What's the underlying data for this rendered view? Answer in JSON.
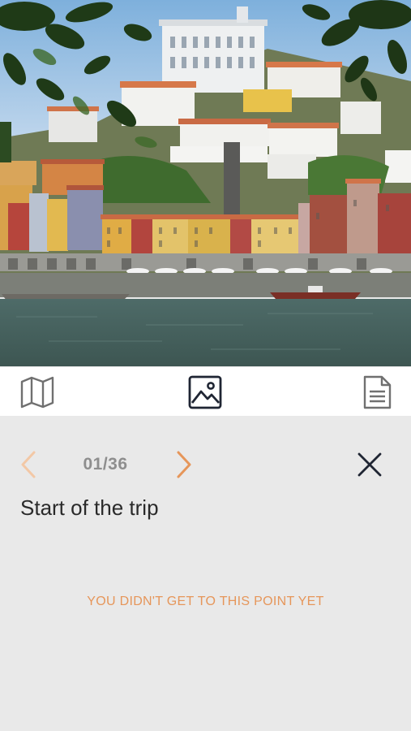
{
  "photo": {
    "subject": "riverside city with colorful houses"
  },
  "toolbar": {
    "items": [
      {
        "icon": "map-icon"
      },
      {
        "icon": "image-icon",
        "active": true
      },
      {
        "icon": "document-icon"
      }
    ]
  },
  "detail": {
    "counter": "01/36",
    "title": "Start of the trip",
    "status": "YOU DIDN'T GET TO THIS POINT YET"
  },
  "colors": {
    "accent": "#e6965a",
    "icon_dark": "#1f2533",
    "icon_gray": "#707070",
    "panel_bg": "#e9e9e9"
  }
}
